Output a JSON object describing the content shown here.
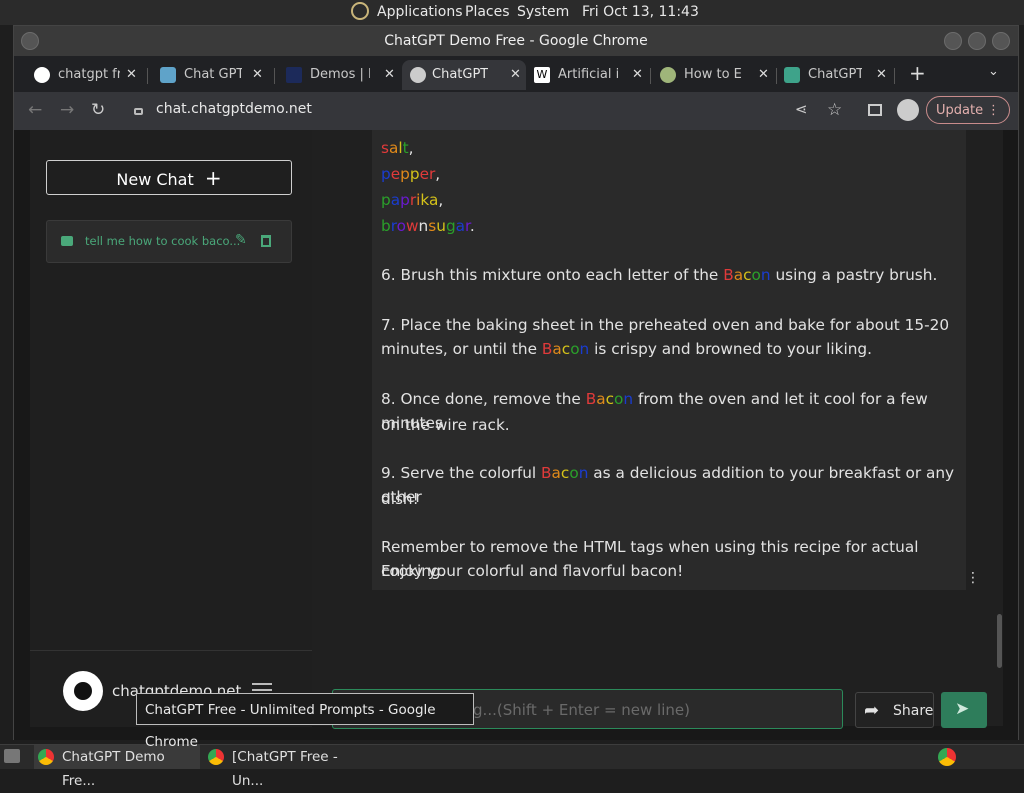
{
  "system_panel": {
    "applications": "Applications",
    "places": "Places",
    "system": "System",
    "clock": "Fri Oct 13, 11:43"
  },
  "window": {
    "title": "ChatGPT Demo Free - Google Chrome"
  },
  "tabs": [
    {
      "label": "chatgpt fre",
      "icon": "google-icon"
    },
    {
      "label": "Chat GPT C",
      "icon": "chat-icon"
    },
    {
      "label": "Demos | In",
      "icon": "demos-icon"
    },
    {
      "label": "ChatGPT D",
      "icon": "globe-icon"
    },
    {
      "label": "Artificial in",
      "icon": "wikipedia-icon"
    },
    {
      "label": "How to Em",
      "icon": "howto-icon"
    },
    {
      "label": "ChatGPT F",
      "icon": "openai-icon"
    }
  ],
  "toolbar": {
    "url": "chat.chatgptdemo.net",
    "update_label": "Update"
  },
  "sidebar": {
    "new_chat_label": "New Chat",
    "chat_items": [
      {
        "label": "tell me how to cook baco..."
      }
    ],
    "site_name": "chatgptdemo.net"
  },
  "message": {
    "colorful_lines": [
      [
        {
          "t": "s",
          "c": "#e03a3a"
        },
        {
          "t": "a",
          "c": "#e08a1a"
        },
        {
          "t": "l",
          "c": "#d4c21a"
        },
        {
          "t": "t",
          "c": "#2aa02a"
        },
        {
          "t": ",",
          "c": "#e2e2e2"
        }
      ],
      [
        {
          "t": "p",
          "c": "#1a3ccf"
        },
        {
          "t": "e",
          "c": "#e03a3a"
        },
        {
          "t": "p",
          "c": "#e08a1a"
        },
        {
          "t": "p",
          "c": "#d4c21a"
        },
        {
          "t": "e",
          "c": "#e03a3a"
        },
        {
          "t": "r",
          "c": "#e03a3a"
        },
        {
          "t": ",",
          "c": "#e2e2e2"
        }
      ],
      [
        {
          "t": "p",
          "c": "#2aa02a"
        },
        {
          "t": "a",
          "c": "#1a3ccf"
        },
        {
          "t": "p",
          "c": "#6a1acf"
        },
        {
          "t": "r",
          "c": "#e03a3a"
        },
        {
          "t": "i",
          "c": "#e08a1a"
        },
        {
          "t": "k",
          "c": "#d4c21a"
        },
        {
          "t": "a",
          "c": "#d4c21a"
        },
        {
          "t": ",",
          "c": "#e2e2e2"
        }
      ],
      [
        {
          "t": "b",
          "c": "#2aa02a"
        },
        {
          "t": "r",
          "c": "#1a3ccf"
        },
        {
          "t": "o",
          "c": "#6a1acf"
        },
        {
          "t": "w",
          "c": "#e03a3a"
        },
        {
          "t": "n",
          "c": "#e2e2e2"
        },
        {
          "t": "s",
          "c": "#e08a1a"
        },
        {
          "t": "u",
          "c": "#d4c21a"
        },
        {
          "t": "g",
          "c": "#2aa02a"
        },
        {
          "t": "a",
          "c": "#1a3ccf"
        },
        {
          "t": "r",
          "c": "#6a1acf"
        },
        {
          "t": ".",
          "c": "#e2e2e2"
        }
      ]
    ],
    "bacon_letters": [
      {
        "t": "B",
        "c": "#e03a3a"
      },
      {
        "t": "a",
        "c": "#e08a1a"
      },
      {
        "t": "c",
        "c": "#d4c21a"
      },
      {
        "t": "o",
        "c": "#2aa02a"
      },
      {
        "t": "n",
        "c": "#1a3ccf"
      }
    ],
    "step6_pre": "6. Brush this mixture onto each letter of the",
    "step6_post": "using a pastry brush.",
    "step7_l1": "7. Place the baking sheet in the preheated oven and bake for about 15-20",
    "step7_pre": "minutes, or until the",
    "step7_post": "is crispy and browned to your liking.",
    "step8_pre": "8. Once done, remove the",
    "step8_post": "from the oven and let it cool for a few minutes",
    "step8_l2": "on the wire rack.",
    "step9_pre": "9. Serve the colorful",
    "step9_post": "as a delicious addition to your breakfast or any other",
    "step9_l2": "dish!",
    "remember_l1": "Remember to remove the HTML tags when using this recipe for actual cooking.",
    "remember_l2": "Enjoy your colorful and flavorful bacon!"
  },
  "composer": {
    "placeholder": "Ask me something...(Shift + Enter = new line)",
    "share_label": "Share"
  },
  "tooltip": {
    "text": "ChatGPT Free - Unlimited Prompts - Google Chrome"
  },
  "taskbar": {
    "task1": "ChatGPT Demo Fre...",
    "task2": "[ChatGPT Free - Un..."
  },
  "colors": {
    "accent_green": "#2e7d5b",
    "sidebar_text_green": "#4aa87a",
    "update_border": "#c98c8c"
  }
}
